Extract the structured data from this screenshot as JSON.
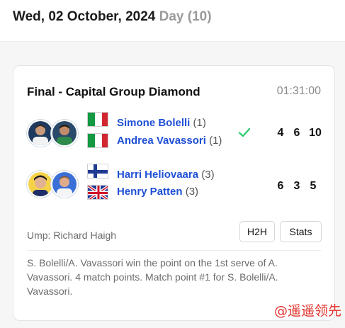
{
  "header": {
    "date": "Wed, 02 October, 2024",
    "day": "Day (10)"
  },
  "match": {
    "title": "Final - Capital Group Diamond",
    "time": "01:31:00",
    "team1": {
      "winner": true,
      "players": [
        {
          "name": "Simone Bolelli",
          "seed": "(1)",
          "flag": "italy-flag"
        },
        {
          "name": "Andrea Vavassori",
          "seed": "(1)",
          "flag": "italy-flag"
        }
      ],
      "scores": [
        "4",
        "6",
        "10"
      ]
    },
    "team2": {
      "winner": false,
      "players": [
        {
          "name": "Harri Heliovaara",
          "seed": "(3)",
          "flag": "finland-flag"
        },
        {
          "name": "Henry Patten",
          "seed": "(3)",
          "flag": "uk-flag"
        }
      ],
      "scores": [
        "6",
        "3",
        "5"
      ]
    },
    "umpire": "Ump: Richard Haigh",
    "buttons": {
      "h2h": "H2H",
      "stats": "Stats"
    },
    "commentary": "S. Bolelli/A. Vavassori win the point on the 1st serve of A. Vavassori. 4 match points. Match point #1 for S. Bolelli/A. Vavassori."
  },
  "watermark": "@遥遥领先",
  "colors": {
    "player_name": "#1f4fd6",
    "winner_check": "#2ecc71",
    "watermark": "#e0312b"
  }
}
